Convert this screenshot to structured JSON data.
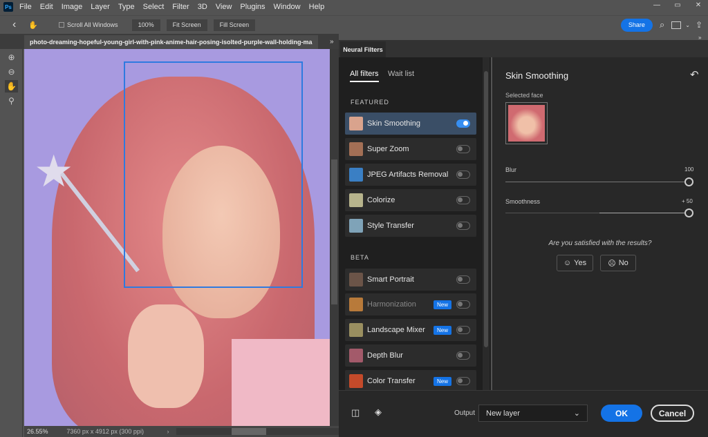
{
  "menubar": {
    "logo": "Ps",
    "items": [
      "File",
      "Edit",
      "Image",
      "Layer",
      "Type",
      "Select",
      "Filter",
      "3D",
      "View",
      "Plugins",
      "Window",
      "Help"
    ]
  },
  "options": {
    "scroll_all": "Scroll All Windows",
    "zoom100": "100%",
    "fit": "Fit Screen",
    "fill": "Fill Screen",
    "share": "Share"
  },
  "document": {
    "tab_title": "photo-dreaming-hopeful-young-girl-with-pink-anime-hair-posing-isolted-purple-wall-holding-ma",
    "zoom": "26.55%",
    "dimensions": "7360 px x 4912 px (300 ppi)"
  },
  "panel": {
    "tab": "Neural Filters",
    "tabs": [
      "All filters",
      "Wait list"
    ],
    "featured_label": "FEATURED",
    "beta_label": "BETA",
    "featured": [
      {
        "label": "Skin Smoothing",
        "on": true
      },
      {
        "label": "Super Zoom",
        "on": false
      },
      {
        "label": "JPEG Artifacts Removal",
        "on": false
      },
      {
        "label": "Colorize",
        "on": false
      },
      {
        "label": "Style Transfer",
        "on": false
      }
    ],
    "beta": [
      {
        "label": "Smart Portrait",
        "new": false
      },
      {
        "label": "Harmonization",
        "new": true,
        "badge": "New"
      },
      {
        "label": "Landscape Mixer",
        "new": true,
        "badge": "New"
      },
      {
        "label": "Depth Blur",
        "new": false
      },
      {
        "label": "Color Transfer",
        "new": true,
        "badge": "New"
      }
    ]
  },
  "detail": {
    "title": "Skin Smoothing",
    "selected_face": "Selected face",
    "blur_label": "Blur",
    "blur_value": "100",
    "blur": 100,
    "smooth_label": "Smoothness",
    "smooth_value": "+ 50",
    "smooth": 50,
    "question": "Are you satisfied with the results?",
    "yes": "Yes",
    "no": "No"
  },
  "footer": {
    "output_label": "Output",
    "output_value": "New layer",
    "ok": "OK",
    "cancel": "Cancel"
  },
  "colors": {
    "accent": "#1473e6",
    "canvas_bg": "#a89ae0"
  }
}
